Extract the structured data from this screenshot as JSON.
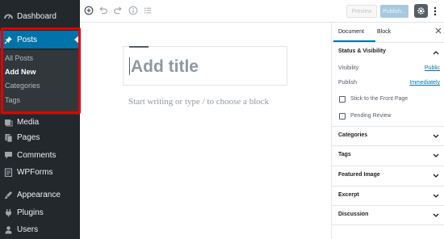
{
  "sidebar": {
    "items": [
      {
        "label": "Dashboard",
        "icon": "dashboard-icon"
      },
      {
        "label": "Posts",
        "icon": "pin-icon",
        "active": true
      },
      {
        "label": "Media",
        "icon": "media-icon"
      },
      {
        "label": "Pages",
        "icon": "pages-icon"
      },
      {
        "label": "Comments",
        "icon": "comments-icon"
      },
      {
        "label": "WPForms",
        "icon": "wpforms-icon"
      },
      {
        "label": "Appearance",
        "icon": "appearance-icon"
      },
      {
        "label": "Plugins",
        "icon": "plugins-icon"
      },
      {
        "label": "Users",
        "icon": "users-icon"
      }
    ],
    "submenu": [
      {
        "label": "All Posts"
      },
      {
        "label": "Add New",
        "current": true
      },
      {
        "label": "Categories"
      },
      {
        "label": "Tags"
      }
    ]
  },
  "toolbar": {
    "icons": [
      "add-block-icon",
      "undo-icon",
      "redo-icon",
      "info-icon",
      "list-view-icon"
    ],
    "preview_label": "Preview",
    "publish_label": "Publish...",
    "settings_icon": "gear-icon",
    "more_icon": "more-vertical-icon"
  },
  "editor": {
    "title_placeholder": "Add title",
    "block_placeholder": "Start writing or type / to choose a block"
  },
  "panel": {
    "tabs": [
      "Document",
      "Block"
    ],
    "active_tab": "Document",
    "close_icon": "close-icon",
    "status": {
      "title": "Status & Visibility",
      "visibility_label": "Visibility",
      "visibility_value": "Public",
      "publish_label": "Publish",
      "publish_value": "Immediately",
      "sticky_label": "Stick to the Front Page",
      "pending_label": "Pending Review"
    },
    "sections": [
      "Categories",
      "Tags",
      "Featured Image",
      "Excerpt",
      "Discussion"
    ]
  },
  "colors": {
    "sidebar_bg": "#23282d",
    "submenu_bg": "#32373c",
    "accent": "#0073aa",
    "highlight": "#e10000"
  }
}
